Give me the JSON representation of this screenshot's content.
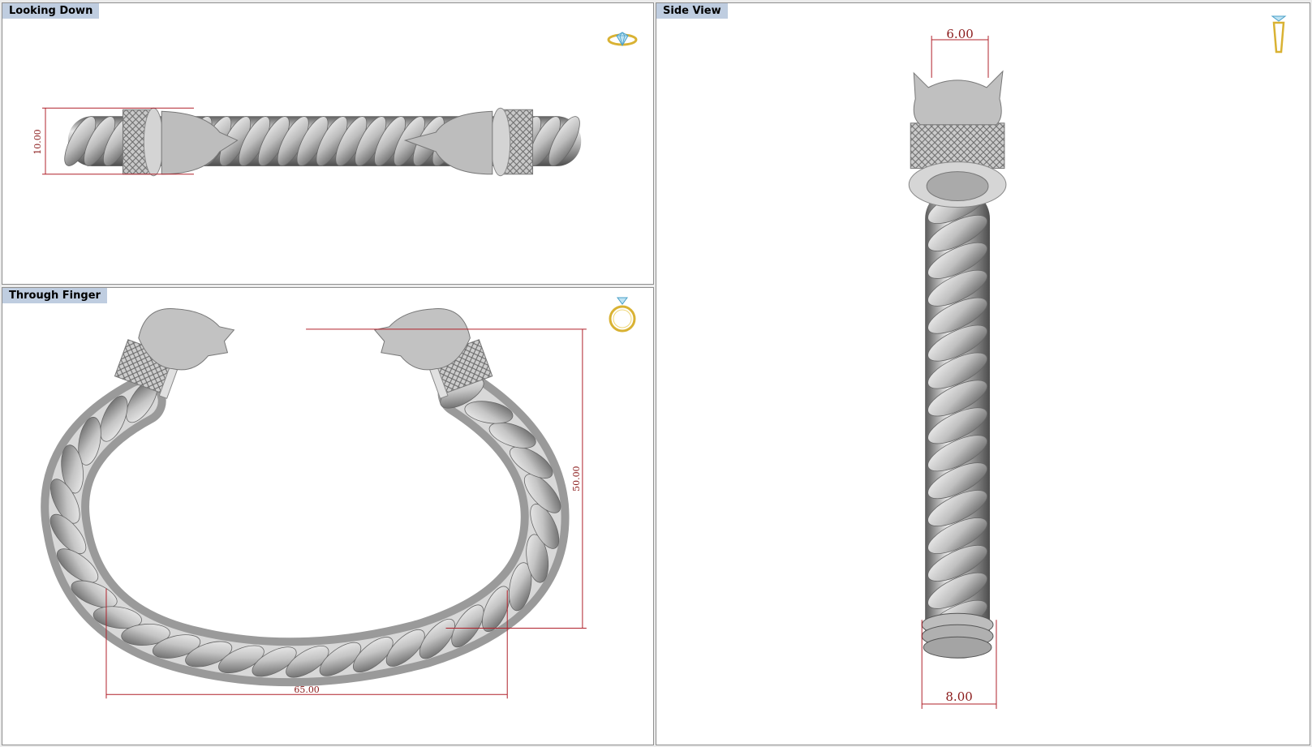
{
  "viewports": {
    "top": {
      "title": "Looking Down",
      "dimension": "10.00",
      "icon": "gem-ring-top-icon"
    },
    "bottom": {
      "title": "Through Finger",
      "dimension_height": "50.00",
      "dimension_width": "65.00",
      "icon": "ring-front-icon"
    },
    "side": {
      "title": "Side View",
      "dimension_top": "6.00",
      "dimension_bottom": "8.00",
      "icon": "ring-side-icon"
    }
  },
  "colors": {
    "dimension": "#b0202a",
    "viewport_title_bg": "#bfcde0",
    "icon_gold": "#d9b233",
    "icon_gem": "#4aa0c8"
  }
}
